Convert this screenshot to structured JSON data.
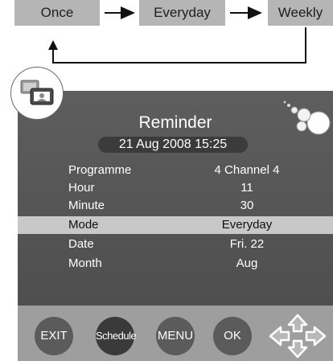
{
  "mode_cycle": {
    "modes": [
      "Once",
      "Everyday",
      "Weekly"
    ]
  },
  "panel": {
    "title": "Reminder",
    "datetime": "21 Aug 2008 15:25",
    "rows": [
      {
        "label": "Programme",
        "value": "4  Channel 4"
      },
      {
        "label": "Hour",
        "value": "11"
      },
      {
        "label": "Minute",
        "value": "30"
      },
      {
        "label": "Mode",
        "value": "Everyday",
        "selected": true
      },
      {
        "label": "Date",
        "value": "Fri. 22"
      },
      {
        "label": "Month",
        "value": "Aug"
      }
    ]
  },
  "buttons": {
    "exit": "EXIT",
    "schedule": "Schedule",
    "menu": "MENU",
    "ok": "OK"
  },
  "colors": {
    "panel": "#555555",
    "highlight": "#c8c8c8",
    "bar": "#9e9e9e",
    "mode_box": "#b5b5b5"
  }
}
